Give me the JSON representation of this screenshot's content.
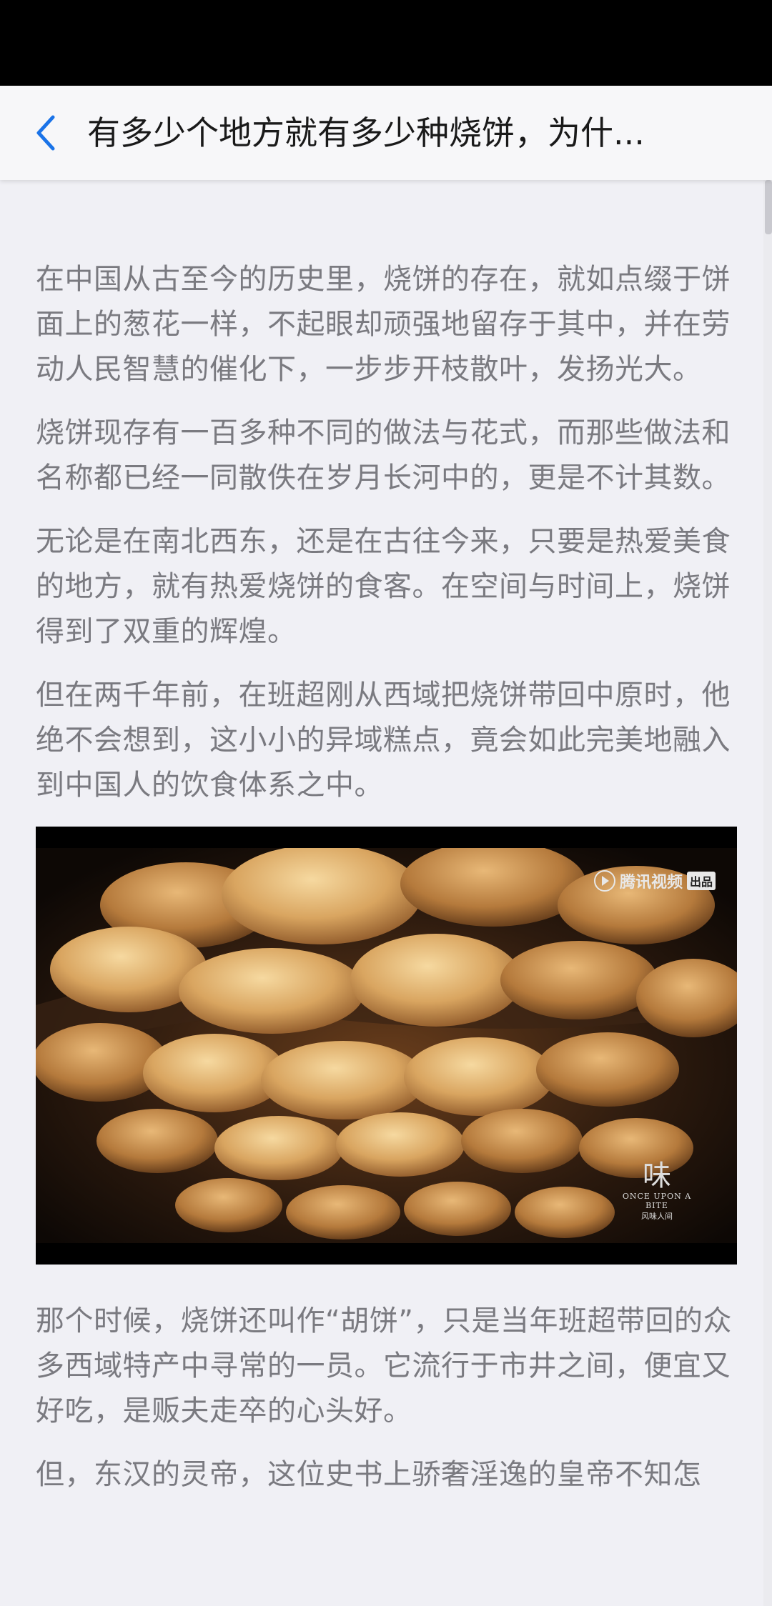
{
  "header": {
    "title": "有多少个地方就有多少种烧饼，为什..."
  },
  "article": {
    "paragraphs_before_image": [
      "在中国从古至今的历史里，烧饼的存在，就如点缀于饼面上的葱花一样，不起眼却顽强地留存于其中，并在劳动人民智慧的催化下，一步步开枝散叶，发扬光大。",
      "烧饼现存有一百多种不同的做法与花式，而那些做法和名称都已经一同散佚在岁月长河中的，更是不计其数。",
      "无论是在南北西东，还是在古往今来，只要是热爱美食的地方，就有热爱烧饼的食客。在空间与时间上，烧饼得到了双重的辉煌。",
      "但在两千年前，在班超刚从西域把烧饼带回中原时，他绝不会想到，这小小的异域糕点，竟会如此完美地融入到中国人的饮食体系之中。"
    ],
    "image": {
      "watermark_brand": "腾讯视频",
      "watermark_badge": "出品",
      "series_logo": "味",
      "series_en": "ONCE UPON A BITE",
      "series_cn": "风味人间"
    },
    "paragraphs_after_image": [
      "那个时候，烧饼还叫作“胡饼”，只是当年班超带回的众多西域特产中寻常的一员。它流行于市井之间，便宜又好吃，是贩夫走卒的心头好。",
      "但，东汉的灵帝，这位史书上骄奢淫逸的皇帝不知怎"
    ]
  },
  "icons": {
    "back": "chevron-left-icon"
  },
  "colors": {
    "accent": "#1a73e8",
    "background": "#f0f0f5",
    "body_text": "#7a7a80",
    "title_text": "#1a1a1a"
  }
}
